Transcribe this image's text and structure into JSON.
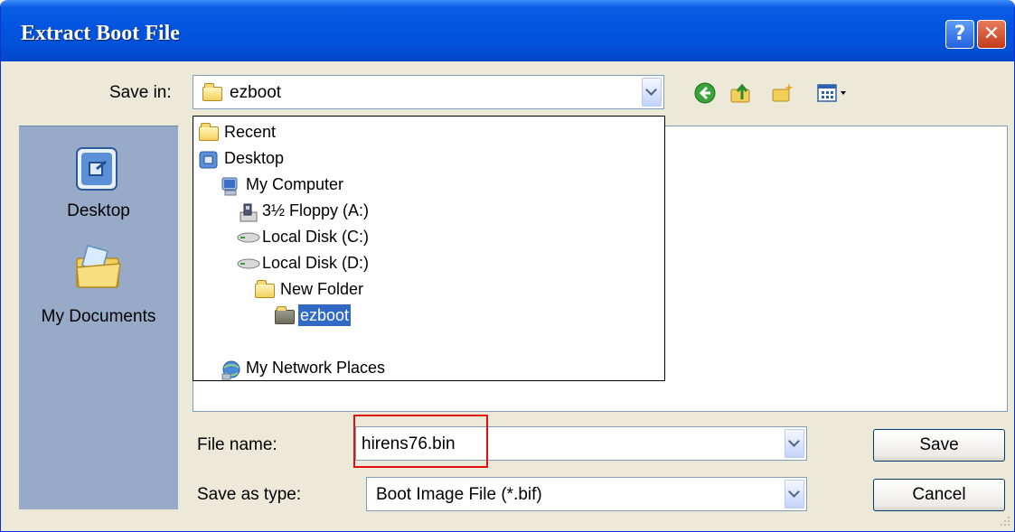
{
  "window": {
    "title": "Extract Boot File"
  },
  "title_buttons": {
    "help": "?",
    "close": "✕"
  },
  "save_in": {
    "label": "Save in:",
    "value": "ezboot"
  },
  "places": [
    {
      "label": "Desktop",
      "icon": "desktop-icon"
    },
    {
      "label": "My Documents",
      "icon": "my-documents-icon"
    }
  ],
  "location_dropdown": {
    "items": [
      {
        "label": "Recent",
        "icon": "folder-icon",
        "level": 0
      },
      {
        "label": "Desktop",
        "icon": "desktop-icon",
        "level": 0
      },
      {
        "label": "My Computer",
        "icon": "my-computer-icon",
        "level": 1
      },
      {
        "label": "3½ Floppy (A:)",
        "icon": "floppy-icon",
        "level": 2
      },
      {
        "label": "Local Disk (C:)",
        "icon": "hard-disk-icon",
        "level": 2
      },
      {
        "label": "Local Disk (D:)",
        "icon": "hard-disk-icon",
        "level": 2
      },
      {
        "label": "New Folder",
        "icon": "folder-icon",
        "level": 3
      },
      {
        "label": "ezboot",
        "icon": "folder-open-icon",
        "level": 4,
        "selected": true
      },
      {
        "label": "My Network Places",
        "icon": "network-places-icon",
        "level": 1
      }
    ]
  },
  "file_name": {
    "label": "File name:",
    "value": "hirens76.bin"
  },
  "save_as_type": {
    "label": "Save as type:",
    "value": "Boot Image File (*.bif)"
  },
  "buttons": {
    "save": "Save",
    "cancel": "Cancel"
  },
  "colors": {
    "titlebar": "#0255e0",
    "selection": "#316ac5",
    "highlight_box": "#e01010",
    "places_bar": "#97aac8"
  }
}
